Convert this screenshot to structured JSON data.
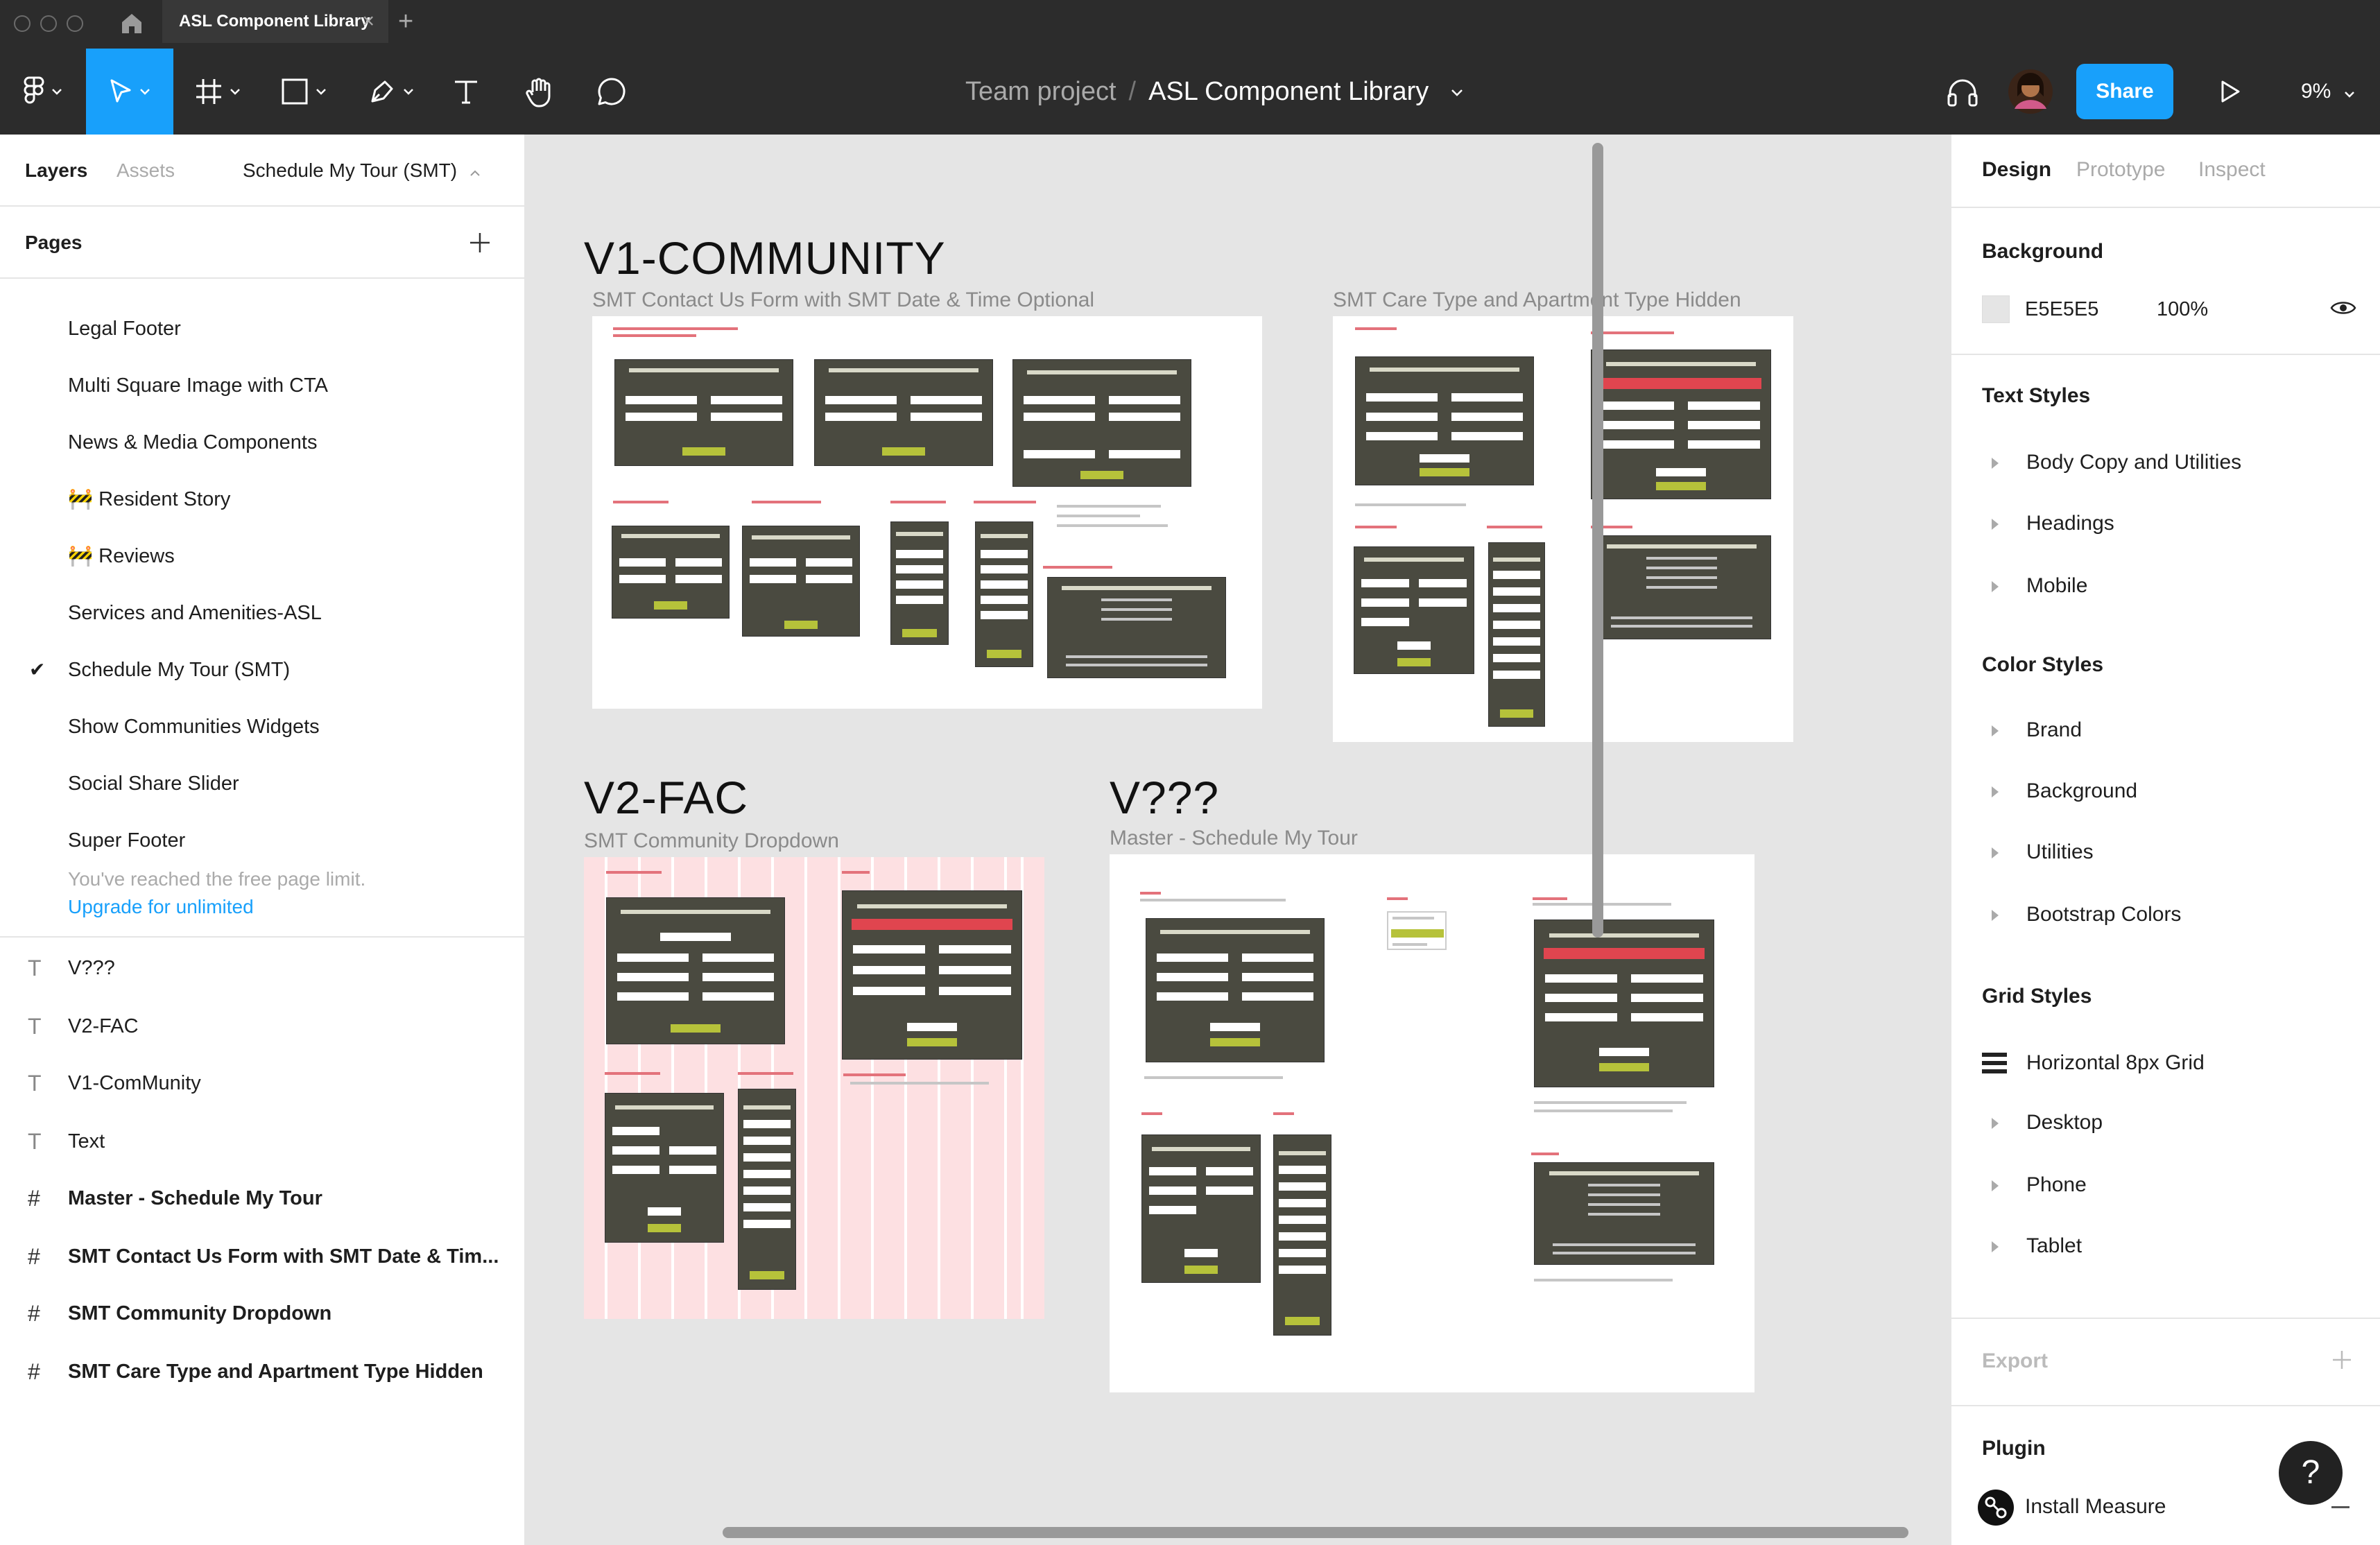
{
  "tab": {
    "title": "ASL Component Library",
    "close": "×",
    "add": "+"
  },
  "toolbar": {
    "project": "Team project",
    "separator": "/",
    "file": "ASL Component Library",
    "share": "Share",
    "zoom": "9%",
    "accent": "#18a0fb"
  },
  "left_panel": {
    "tabs": {
      "layers": "Layers",
      "assets": "Assets",
      "current_page": "Schedule My Tour (SMT)"
    },
    "pages_title": "Pages",
    "pages": [
      "Legal Footer",
      "Multi Square Image with CTA",
      "News & Media Components",
      "🚧 Resident Story",
      "🚧 Reviews",
      "Services and Amenities-ASL",
      "Schedule My Tour (SMT)",
      "Show Communities Widgets",
      "Social Share Slider",
      "Super Footer"
    ],
    "selected_page_check": "✔",
    "limit_text": "You've reached the free page limit.",
    "upgrade_text": "Upgrade for unlimited",
    "layers": [
      {
        "icon": "T",
        "label": "V???"
      },
      {
        "icon": "T",
        "label": "V2-FAC"
      },
      {
        "icon": "T",
        "label": "V1-ComMunity"
      },
      {
        "icon": "T",
        "label": "Text"
      },
      {
        "icon": "#",
        "label": "Master - Schedule My Tour"
      },
      {
        "icon": "#",
        "label": "SMT Contact Us Form with SMT Date & Tim..."
      },
      {
        "icon": "#",
        "label": "SMT Community Dropdown"
      },
      {
        "icon": "#",
        "label": "SMT Care Type and Apartment Type Hidden"
      }
    ]
  },
  "canvas": {
    "background": "#E5E5E5",
    "v1_title": "V1-COMMUNITY",
    "v1_sub": "SMT Contact Us Form with SMT Date & Time Optional",
    "care_sub": "SMT Care Type and Apartment Type Hidden",
    "v2_title": "V2-FAC",
    "v2_sub": "SMT Community Dropdown",
    "v3_title": "V???",
    "v3_sub": "Master - Schedule My Tour"
  },
  "right_panel": {
    "tabs": {
      "design": "Design",
      "prototype": "Prototype",
      "inspect": "Inspect"
    },
    "background_title": "Background",
    "background_hex": "E5E5E5",
    "background_opacity": "100%",
    "text_styles_title": "Text Styles",
    "text_styles": [
      "Body Copy and Utilities",
      "Headings",
      "Mobile"
    ],
    "color_styles_title": "Color Styles",
    "color_styles": [
      "Brand",
      "Background",
      "Utilities",
      "Bootstrap Colors"
    ],
    "grid_styles_title": "Grid Styles",
    "grid_styles": [
      "Horizontal 8px Grid",
      "Desktop",
      "Phone",
      "Tablet"
    ],
    "export_title": "Export",
    "plugin_title": "Plugin",
    "plugin_item": "Install Measure",
    "help": "?"
  }
}
